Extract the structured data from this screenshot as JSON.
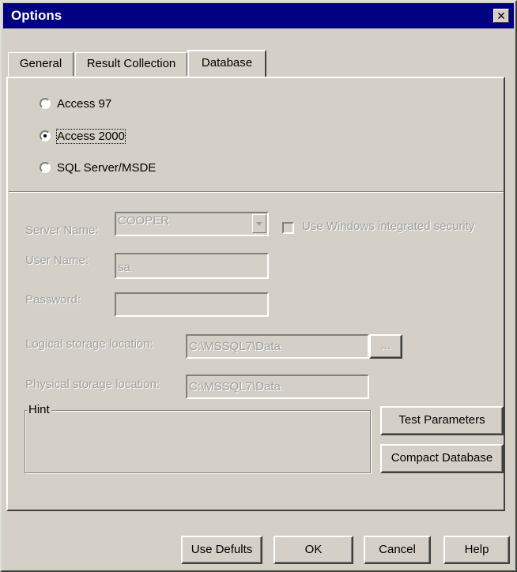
{
  "window": {
    "title": "Options",
    "close_glyph": "✕"
  },
  "tabs": [
    {
      "label": "General"
    },
    {
      "label": "Result Collection"
    },
    {
      "label": "Database",
      "active": true
    }
  ],
  "database_type": {
    "options": [
      {
        "label": "Access 97",
        "checked": false
      },
      {
        "label": "Access 2000",
        "checked": true
      },
      {
        "label": "SQL Server/MSDE",
        "checked": false
      }
    ]
  },
  "sql_settings": {
    "server_name_label": "Server Name:",
    "server_name_value": "COOPER",
    "integrated_security_label": "Use Windows integrated security",
    "user_name_label": "User Name:",
    "user_name_value": "sa",
    "password_label": "Password:",
    "password_value": "",
    "logical_location_label": "Logical storage location:",
    "logical_location_value": "C:\\MSSQL7\\Data",
    "browse_label": "...",
    "physical_location_label": "Physical storage location:",
    "physical_location_value": "C:\\MSSQL7\\Data"
  },
  "hint": {
    "label": "Hint"
  },
  "side_buttons": {
    "test_label": "Test Parameters",
    "compact_label": "Compact Database"
  },
  "footer": {
    "defaults_label": "Use Defults",
    "ok_label": "OK",
    "cancel_label": "Cancel",
    "help_label": "Help"
  }
}
